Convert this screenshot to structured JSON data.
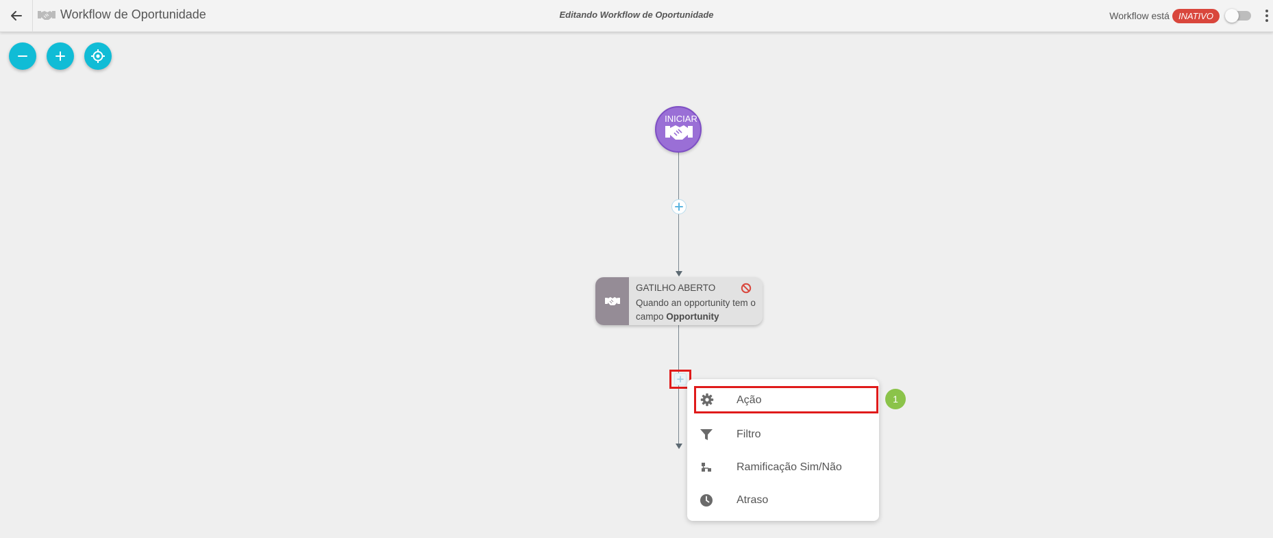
{
  "header": {
    "title": "Workflow de Oportunidade",
    "center_text": "Editando Workflow de Oportunidade",
    "status_label": "Workflow está",
    "status_badge": "INATIVO",
    "status_color": "#d9463c",
    "toggle_on": false
  },
  "icons": {
    "back": "arrow-left-icon",
    "app": "handshake-icon",
    "more": "kebab-menu-icon",
    "zoom_out": "minus-icon",
    "zoom_in": "plus-icon",
    "center": "crosshair-icon"
  },
  "canvas": {
    "start_node": {
      "label": "INICIAR",
      "icon": "handshake-icon",
      "color": "#9a6fd6"
    },
    "trigger_node": {
      "title": "GATILHO ABERTO",
      "desc_prefix": "Quando an opportunity tem o campo ",
      "desc_bold": "Opportunity",
      "icon": "handshake-icon",
      "status_icon": "block-icon"
    }
  },
  "menu": {
    "items": [
      {
        "label": "Ação",
        "icon": "gear-icon"
      },
      {
        "label": "Filtro",
        "icon": "filter-icon"
      },
      {
        "label": "Ramificação Sim/Não",
        "icon": "branch-icon"
      },
      {
        "label": "Atraso",
        "icon": "clock-icon"
      }
    ]
  },
  "annotation": {
    "step": "1",
    "color": "#8bc34a"
  },
  "colors": {
    "accent": "#10bcd6",
    "highlight": "#e01b1b"
  }
}
